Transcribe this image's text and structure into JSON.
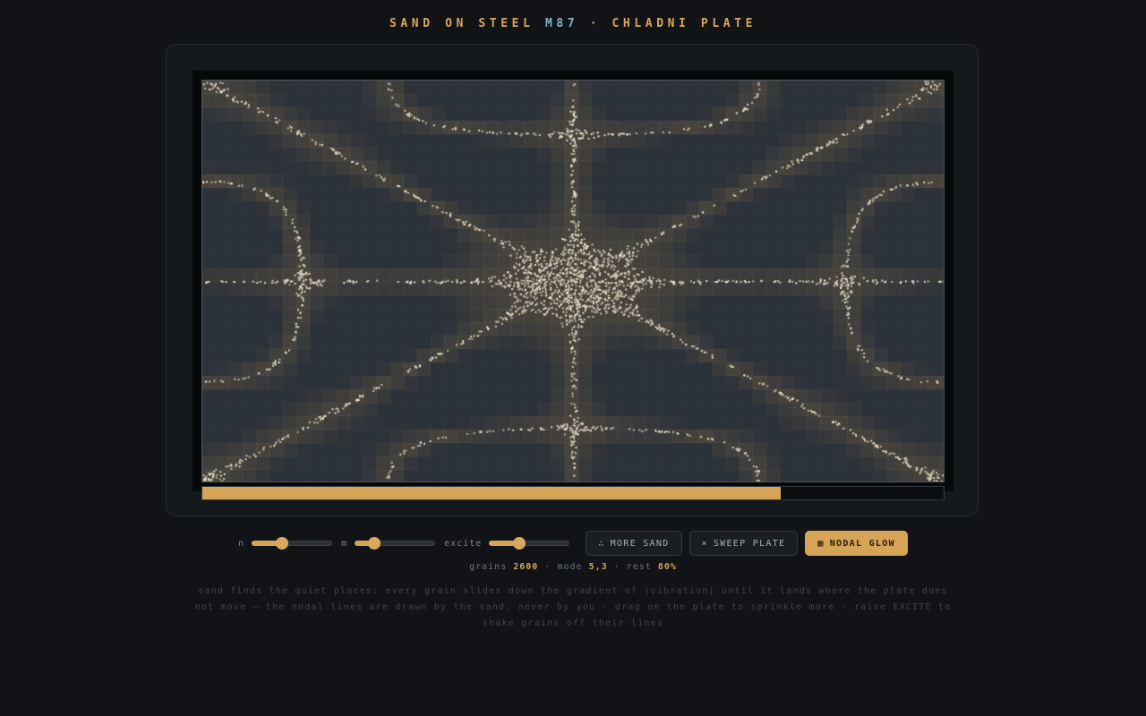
{
  "title": {
    "part1": "SAND ON STEEL ",
    "code": "M87",
    "part2": " · CHLADNI PLATE"
  },
  "plate": {
    "mode_n": 5,
    "mode_m": 3,
    "progress": 0.78
  },
  "controls": {
    "n_label": "n",
    "n_value": 0.38,
    "m_label": "m",
    "m_value": 0.24,
    "excite_label": "excite",
    "excite_value": 0.38,
    "more_sand_icon": "∴",
    "more_sand_label": "MORE SAND",
    "sweep_icon": "×",
    "sweep_label": "SWEEP PLATE",
    "glow_icon": "▦",
    "glow_label": "NODAL GLOW"
  },
  "stats": {
    "grains_label": "grains",
    "grains": "2600",
    "mode_label": "mode",
    "mode": "5,3",
    "rest_label": "rest",
    "rest": "80%",
    "sep": "·"
  },
  "description": "sand finds the quiet places: every grain slides down the gradient of |vibration| until it lands where the plate does not move — the nodal lines are drawn by the sand, never by you · drag on the plate to sprinkle more · raise EXCITE to shake grains off their lines",
  "colors": {
    "accent": "#d6a456",
    "code": "#7fb6c4",
    "sand": "#efe6cf",
    "plate": "#2c323a"
  },
  "icons": {
    "more_sand": "sand-dots-icon",
    "sweep": "close-icon",
    "glow": "grid-icon"
  }
}
